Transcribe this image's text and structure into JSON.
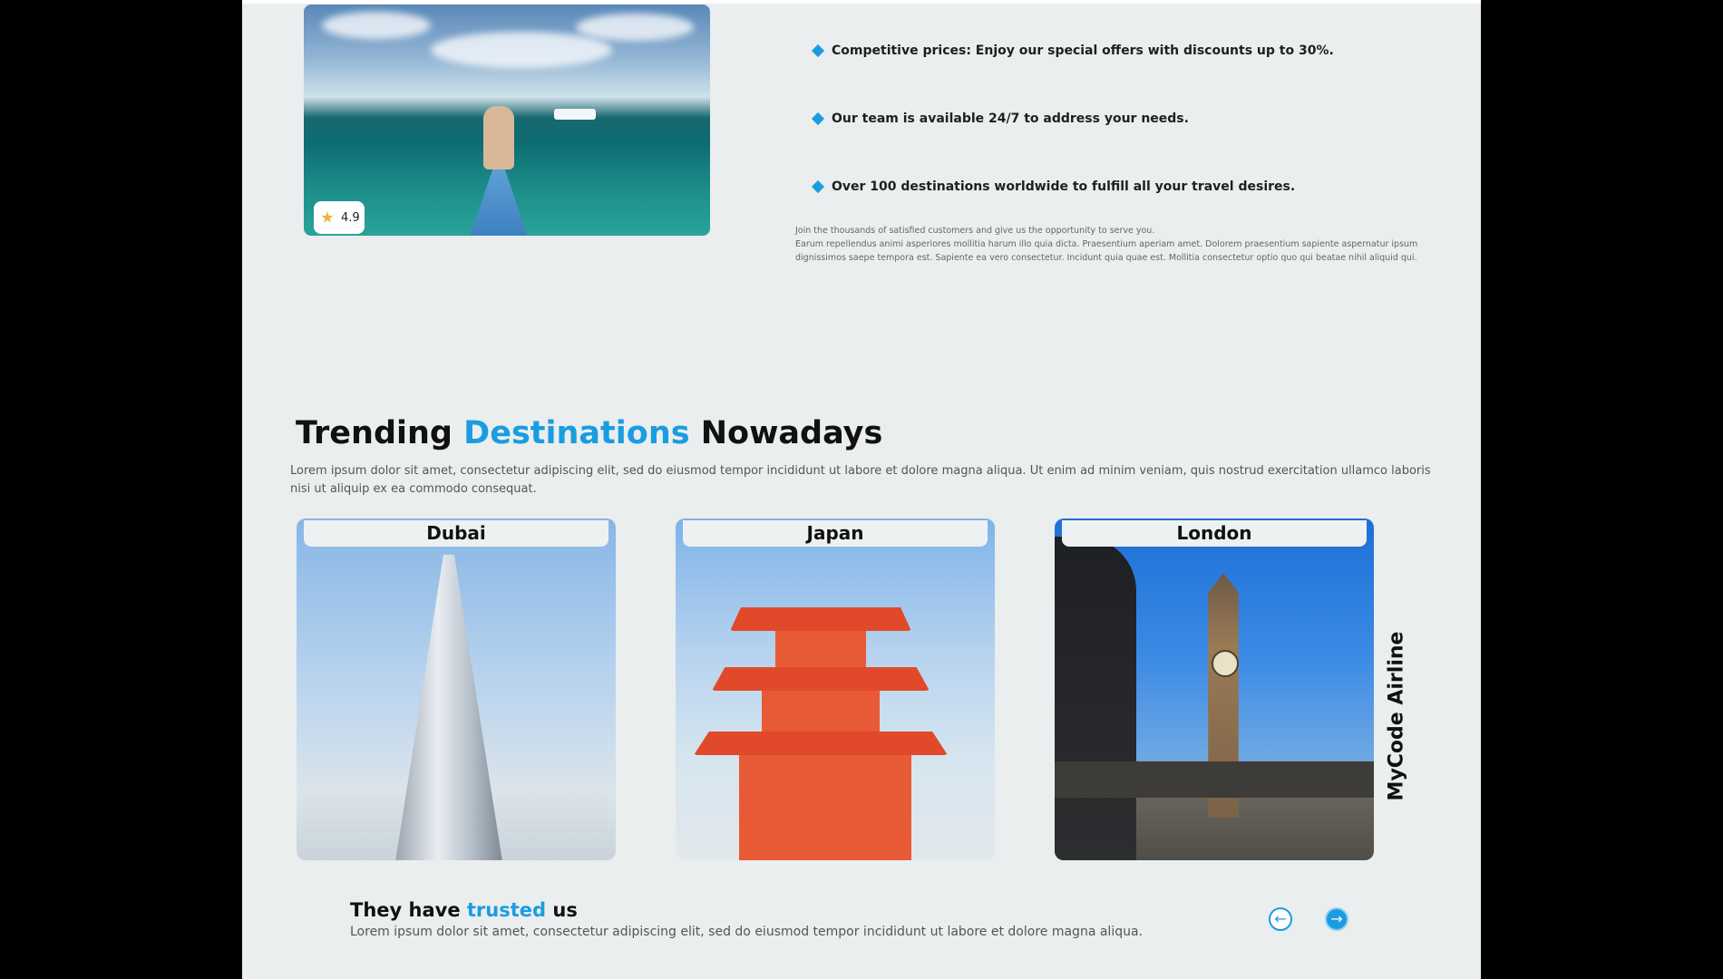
{
  "hero": {
    "rating": "4.9",
    "rating_icon": "star-icon"
  },
  "features": [
    "Competitive prices: Enjoy our special offers with discounts up to 30%.",
    "Our team is available 24/7 to address your needs.",
    "Over 100 destinations worldwide to fulfill all your travel desires."
  ],
  "feature_icon": "diamond-bullet-icon",
  "feature_note": {
    "line1": "Join the thousands of satisfied customers and give us the opportunity to serve you.",
    "line2": "Earum repellendus animi asperiores mollitia harum illo quia dicta. Praesentium aperiam amet. Dolorem praesentium sapiente aspernatur ipsum dignissimos saepe tempora est. Sapiente ea vero consectetur. Incidunt quia quae est. Mollitia consectetur optio quo qui beatae nihil aliquid qui."
  },
  "trending": {
    "title_part1": "Trending",
    "title_accent": "Destinations",
    "title_part2": "Nowadays",
    "description": "Lorem ipsum dolor sit amet, consectetur adipiscing elit, sed do eiusmod tempor incididunt ut labore et dolore magna aliqua. Ut enim ad minim veniam, quis nostrud exercitation ullamco laboris nisi ut aliquip ex ea commodo consequat.",
    "cards": [
      "Dubai",
      "Japan",
      "London"
    ]
  },
  "brand_vertical": "MyCode Airline",
  "trusted": {
    "title_part1": "They have",
    "title_accent": "trusted",
    "title_part2": "us",
    "description": "Lorem ipsum dolor sit amet, consectetur adipiscing elit, sed do eiusmod tempor incididunt ut labore et dolore magna aliqua."
  },
  "nav": {
    "prev_icon": "arrow-left-circle-icon",
    "next_icon": "arrow-right-circle-icon"
  },
  "colors": {
    "accent": "#1a9de0",
    "page_background": "#eaeeee",
    "outer_background": "#000000"
  }
}
